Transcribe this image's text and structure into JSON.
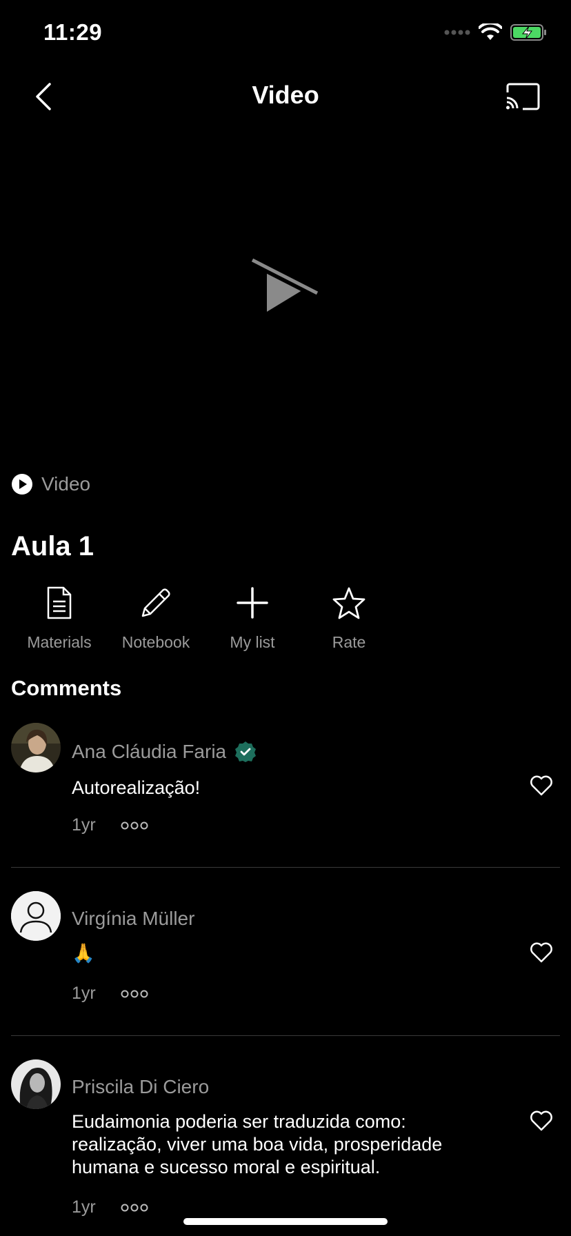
{
  "status_bar": {
    "time": "11:29"
  },
  "nav": {
    "title": "Video",
    "back_icon": "chevron-left-icon",
    "cast_icon": "cast-icon"
  },
  "content": {
    "type_label": "Video",
    "title": "Aula 1"
  },
  "actions": [
    {
      "label": "Materials",
      "icon": "document-icon"
    },
    {
      "label": "Notebook",
      "icon": "pencil-icon"
    },
    {
      "label": "My list",
      "icon": "plus-icon"
    },
    {
      "label": "Rate",
      "icon": "star-icon"
    }
  ],
  "comments_heading": "Comments",
  "comments": [
    {
      "author": "Ana Cláudia Faria",
      "verified": true,
      "text": "Autorealização!",
      "time": "1yr"
    },
    {
      "author": "Virgínia Müller",
      "verified": false,
      "text": "🙏",
      "time": "1yr"
    },
    {
      "author": "Priscila Di Ciero",
      "verified": false,
      "text": "Eudaimonia poderia ser traduzida como: realização, viver uma boa vida, prosperidade humana e sucesso moral e espiritual.",
      "time": "1yr"
    }
  ],
  "colors": {
    "accent_verified": "#1d6e5c",
    "battery": "#4cd964",
    "muted_text": "#9b9b9b"
  }
}
